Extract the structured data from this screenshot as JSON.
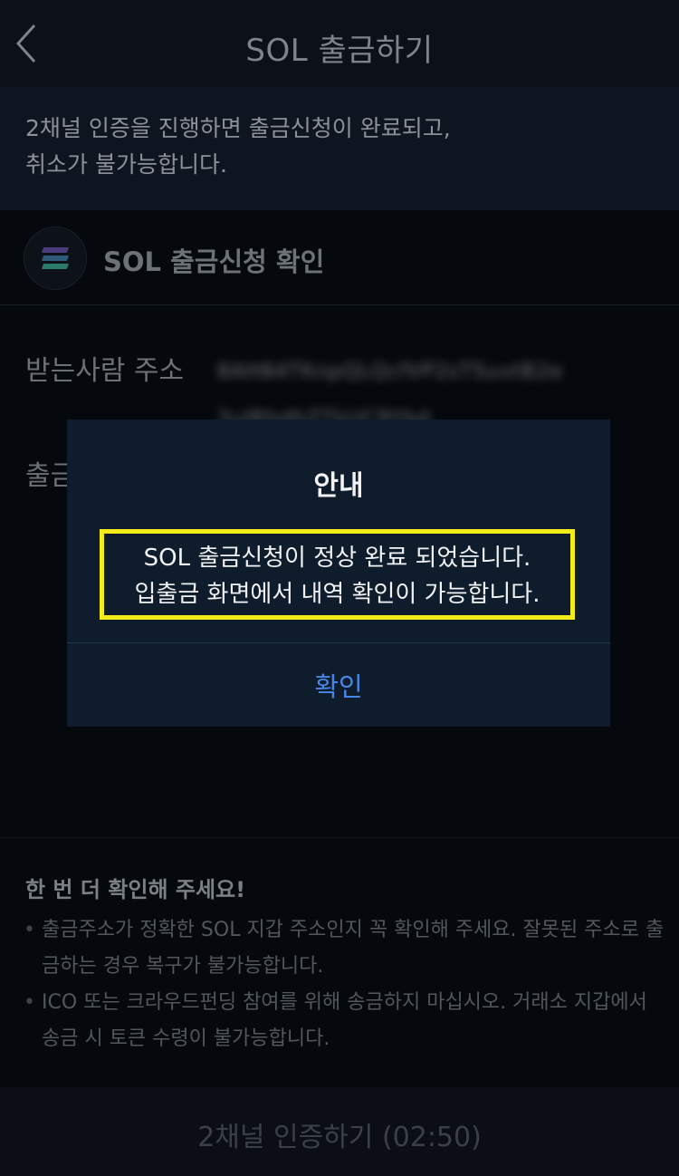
{
  "header": {
    "title": "SOL 출금하기"
  },
  "notice": {
    "text": "2채널 인증을 진행하면 출금신청이 완료되고,\n취소가 불가능합니다."
  },
  "section": {
    "title": "SOL 출금신청 확인",
    "coin_icon": "solana-icon"
  },
  "recipient": {
    "label": "받는사람 주소",
    "value": "8AH84TKnpQLQcfVP2sTSuvtB2e3uJRhdhZTkUC9Ybd"
  },
  "amount": {
    "label": "출금"
  },
  "warning": {
    "title": "한 번 더 확인해 주세요!",
    "items": [
      "출금주소가 정확한 SOL 지갑 주소인지 꼭 확인해 주세요. 잘못된 주소로 출금하는 경우 복구가 불가능합니다.",
      "ICO 또는 크라우드펀딩 참여를 위해 송금하지 마십시오. 거래소 지갑에서 송금 시 토큰 수령이 불가능합니다."
    ]
  },
  "cta": {
    "label": "2채널 인증하기 (02:50)"
  },
  "modal": {
    "title": "안내",
    "message_line1": "SOL 출금신청이 정상 완료 되었습니다.",
    "message_line2": "입출금 화면에서 내역 확인이 가능합니다.",
    "confirm_label": "확인"
  },
  "colors": {
    "background": "#05080d",
    "modal_bg": "#0f1c2b",
    "highlight": "#f4ec18",
    "confirm_text": "#4a86e8"
  }
}
